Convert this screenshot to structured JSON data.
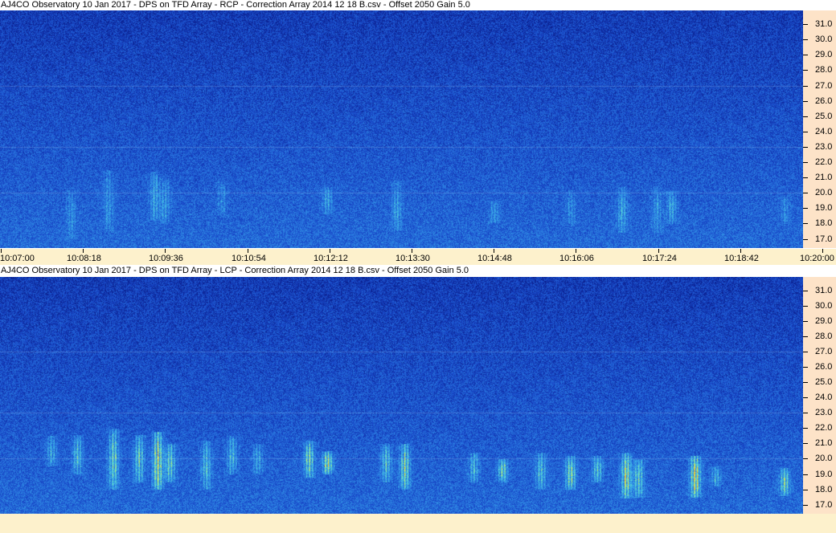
{
  "chart_data": [
    {
      "type": "heatmap",
      "title": "AJ4CO Observatory 10 Jan 2017  -  DPS on TFD Array  -  RCP  -  Correction Array 2014 12 18 B.csv  -  Offset 2050  Gain 5.0",
      "polarization": "RCP",
      "xlabel": "",
      "ylabel": "",
      "y_ticks": [
        "31.0",
        "30.0",
        "29.0",
        "28.0",
        "27.0",
        "26.0",
        "25.0",
        "24.0",
        "23.0",
        "22.0",
        "21.0",
        "20.0",
        "19.0",
        "18.0",
        "17.0"
      ],
      "y_values": [
        31,
        30,
        29,
        28,
        27,
        26,
        25,
        24,
        23,
        22,
        21,
        20,
        19,
        18,
        17
      ],
      "x_ticks": [
        "10:07:00",
        "10:08:18",
        "10:09:36",
        "10:10:54",
        "10:12:12",
        "10:13:30",
        "10:14:48",
        "10:16:06",
        "10:17:24",
        "10:18:42",
        "10:20:00"
      ],
      "xlim": [
        "10:07:00",
        "10:20:00"
      ],
      "ylim": [
        16.4,
        31.9
      ],
      "colormap": [
        "#0a1e8c",
        "#1848c8",
        "#2a7ae0",
        "#3cb4e8",
        "#6ee0c0",
        "#e8e840",
        "#f08020",
        "#d02020"
      ],
      "emission_bursts": [
        {
          "time": "10:08:09",
          "f_low": 17.0,
          "f_high": 20.2,
          "intensity": 0.25
        },
        {
          "time": "10:08:45",
          "f_low": 17.5,
          "f_high": 21.5,
          "intensity": 0.3
        },
        {
          "time": "10:09:30",
          "f_low": 18.2,
          "f_high": 21.4,
          "intensity": 0.4
        },
        {
          "time": "10:09:40",
          "f_low": 18.0,
          "f_high": 21.0,
          "intensity": 0.35
        },
        {
          "time": "10:10:35",
          "f_low": 18.5,
          "f_high": 20.8,
          "intensity": 0.25
        },
        {
          "time": "10:12:18",
          "f_low": 18.6,
          "f_high": 20.4,
          "intensity": 0.4
        },
        {
          "time": "10:13:25",
          "f_low": 17.5,
          "f_high": 20.8,
          "intensity": 0.35
        },
        {
          "time": "10:15:00",
          "f_low": 18.0,
          "f_high": 19.5,
          "intensity": 0.3
        },
        {
          "time": "10:16:14",
          "f_low": 18.0,
          "f_high": 20.2,
          "intensity": 0.25
        },
        {
          "time": "10:17:04",
          "f_low": 17.4,
          "f_high": 20.4,
          "intensity": 0.4
        },
        {
          "time": "10:17:38",
          "f_low": 17.4,
          "f_high": 20.4,
          "intensity": 0.3
        },
        {
          "time": "10:17:52",
          "f_low": 18.0,
          "f_high": 20.2,
          "intensity": 0.4
        },
        {
          "time": "10:19:42",
          "f_low": 18.0,
          "f_high": 19.8,
          "intensity": 0.25
        }
      ]
    },
    {
      "type": "heatmap",
      "title": "AJ4CO Observatory 10 Jan 2017  -  DPS on TFD Array  -  LCP  -  Correction Array 2014 12 18 B.csv  -  Offset 2050  Gain 5.0",
      "polarization": "LCP",
      "xlabel": "",
      "ylabel": "",
      "y_ticks": [
        "31.0",
        "30.0",
        "29.0",
        "28.0",
        "27.0",
        "26.0",
        "25.0",
        "24.0",
        "23.0",
        "22.0",
        "21.0",
        "20.0",
        "19.0",
        "18.0",
        "17.0"
      ],
      "y_values": [
        31,
        30,
        29,
        28,
        27,
        26,
        25,
        24,
        23,
        22,
        21,
        20,
        19,
        18,
        17
      ],
      "xlim": [
        "10:07:00",
        "10:20:00"
      ],
      "ylim": [
        16.4,
        31.9
      ],
      "colormap": [
        "#0a1e8c",
        "#1848c8",
        "#2a7ae0",
        "#3cb4e8",
        "#6ee0c0",
        "#e8e840",
        "#f08020",
        "#d02020"
      ],
      "emission_bursts": [
        {
          "time": "10:07:50",
          "f_low": 19.5,
          "f_high": 21.5,
          "intensity": 0.45
        },
        {
          "time": "10:08:15",
          "f_low": 19.0,
          "f_high": 21.6,
          "intensity": 0.55
        },
        {
          "time": "10:08:50",
          "f_low": 18.0,
          "f_high": 22.0,
          "intensity": 0.7
        },
        {
          "time": "10:09:15",
          "f_low": 18.5,
          "f_high": 21.6,
          "intensity": 0.65
        },
        {
          "time": "10:09:33",
          "f_low": 18.0,
          "f_high": 21.8,
          "intensity": 0.95
        },
        {
          "time": "10:09:45",
          "f_low": 18.5,
          "f_high": 21.0,
          "intensity": 0.7
        },
        {
          "time": "10:10:20",
          "f_low": 18.0,
          "f_high": 21.2,
          "intensity": 0.55
        },
        {
          "time": "10:10:45",
          "f_low": 19.0,
          "f_high": 21.5,
          "intensity": 0.5
        },
        {
          "time": "10:11:10",
          "f_low": 19.0,
          "f_high": 21.0,
          "intensity": 0.4
        },
        {
          "time": "10:12:00",
          "f_low": 18.8,
          "f_high": 21.2,
          "intensity": 0.75
        },
        {
          "time": "10:12:18",
          "f_low": 19.0,
          "f_high": 20.5,
          "intensity": 0.85
        },
        {
          "time": "10:13:15",
          "f_low": 18.5,
          "f_high": 21.0,
          "intensity": 0.6
        },
        {
          "time": "10:13:33",
          "f_low": 18.0,
          "f_high": 21.0,
          "intensity": 0.8
        },
        {
          "time": "10:14:40",
          "f_low": 18.5,
          "f_high": 20.4,
          "intensity": 0.5
        },
        {
          "time": "10:15:08",
          "f_low": 18.5,
          "f_high": 20.0,
          "intensity": 0.7
        },
        {
          "time": "10:15:45",
          "f_low": 18.0,
          "f_high": 20.4,
          "intensity": 0.55
        },
        {
          "time": "10:16:14",
          "f_low": 18.0,
          "f_high": 20.2,
          "intensity": 0.75
        },
        {
          "time": "10:16:40",
          "f_low": 18.5,
          "f_high": 20.2,
          "intensity": 0.6
        },
        {
          "time": "10:17:08",
          "f_low": 17.4,
          "f_high": 20.4,
          "intensity": 0.9
        },
        {
          "time": "10:17:20",
          "f_low": 17.5,
          "f_high": 20.0,
          "intensity": 0.65
        },
        {
          "time": "10:18:15",
          "f_low": 17.5,
          "f_high": 20.2,
          "intensity": 1.0
        },
        {
          "time": "10:18:35",
          "f_low": 18.2,
          "f_high": 19.5,
          "intensity": 0.45
        },
        {
          "time": "10:19:42",
          "f_low": 17.6,
          "f_high": 19.4,
          "intensity": 0.7
        }
      ]
    }
  ]
}
